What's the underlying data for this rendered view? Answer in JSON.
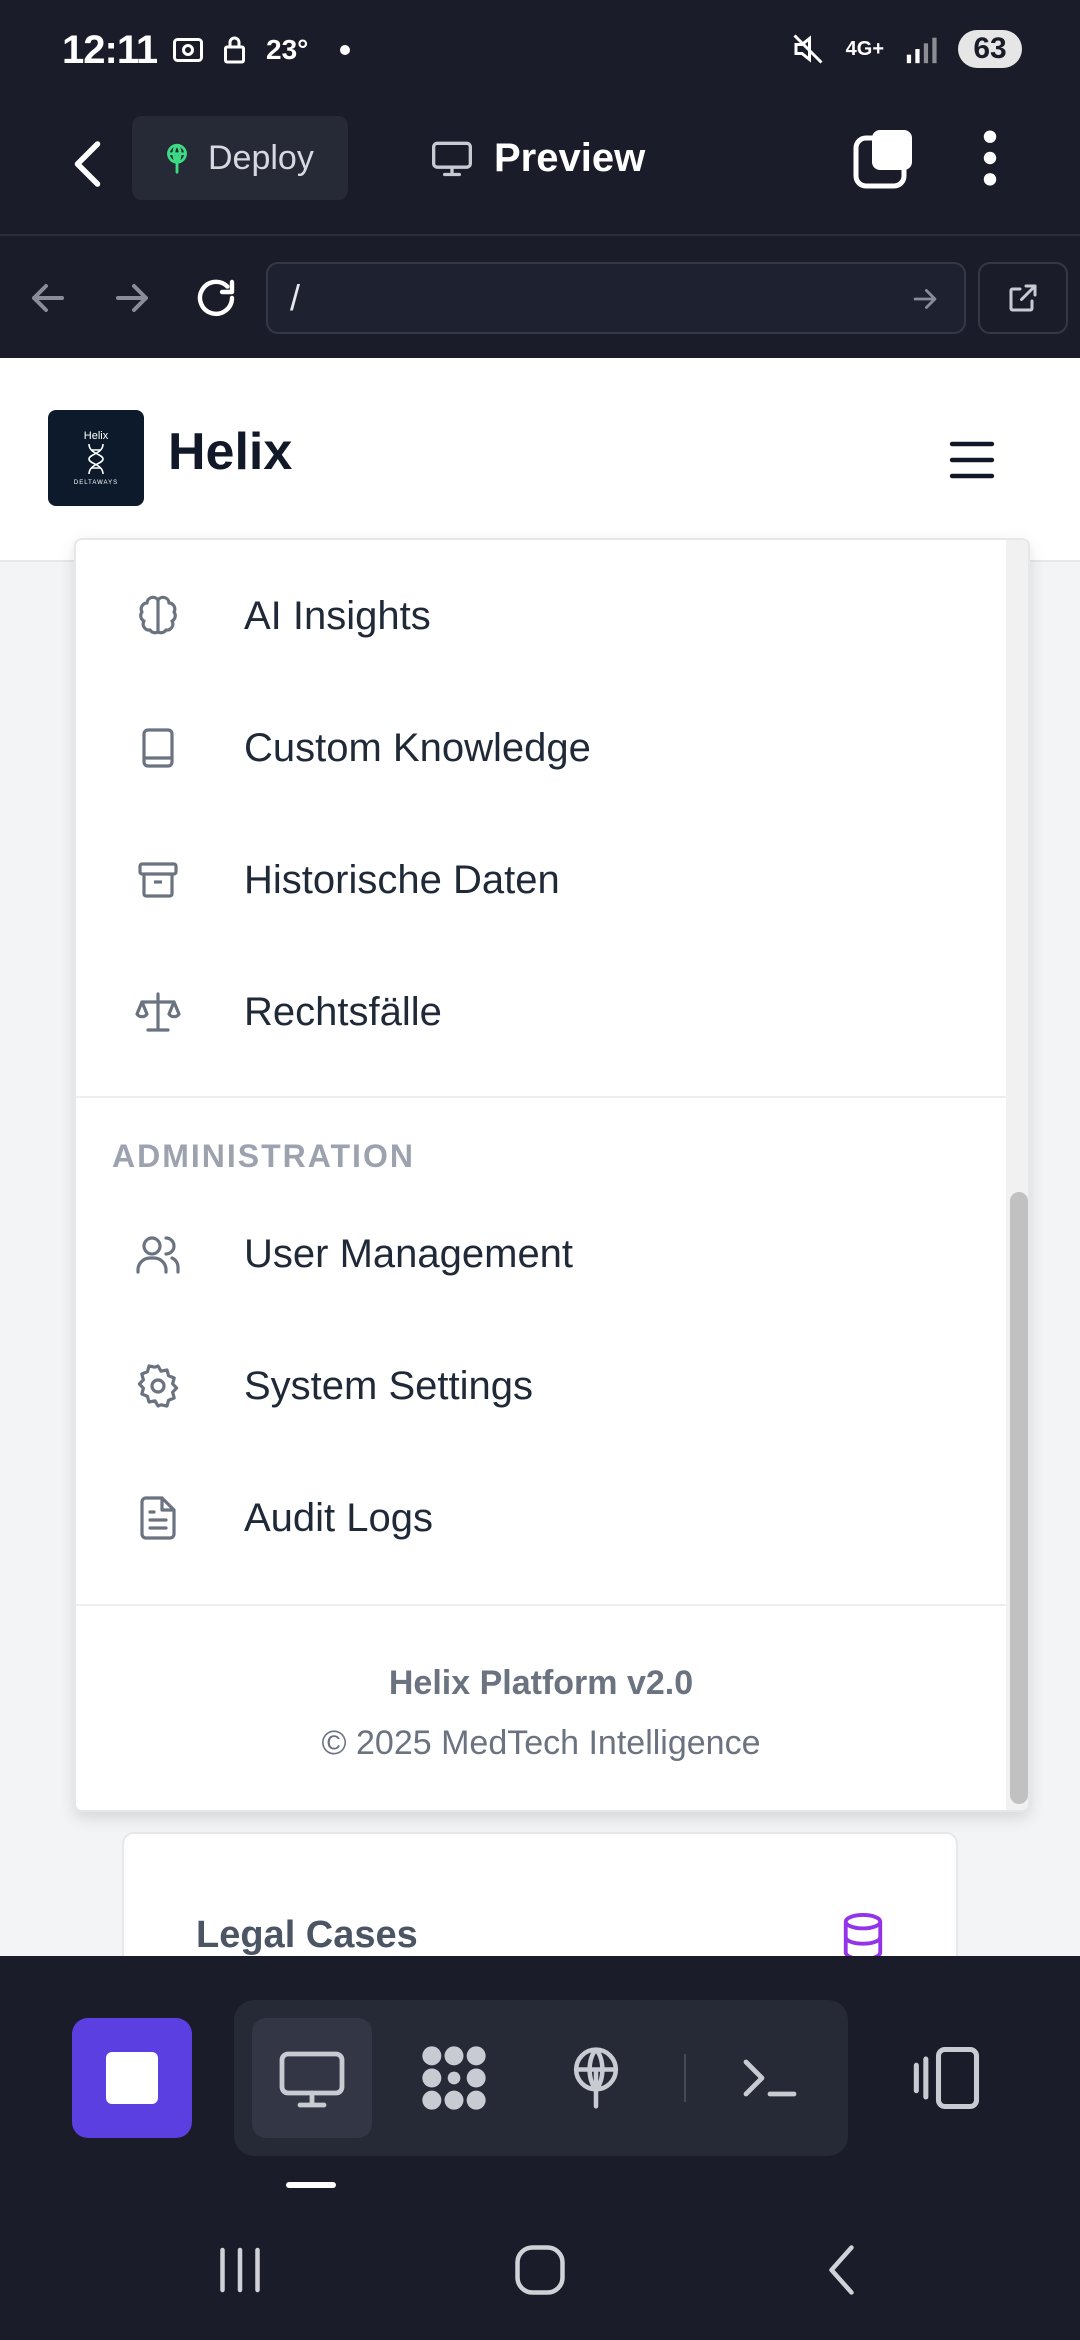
{
  "status_bar": {
    "time": "12:11",
    "temperature": "23°",
    "network": "4G+",
    "battery": "63"
  },
  "app_bar": {
    "deploy_label": "Deploy",
    "preview_label": "Preview"
  },
  "url_bar": {
    "url": "/"
  },
  "site": {
    "brand": "Helix",
    "logo_text": "Helix",
    "logo_sub": "DELTAWAYS"
  },
  "menu": {
    "items": [
      {
        "label": "AI Insights",
        "icon": "brain-icon"
      },
      {
        "label": "Custom Knowledge",
        "icon": "book-icon"
      },
      {
        "label": "Historische Daten",
        "icon": "archive-icon"
      },
      {
        "label": "Rechtsfälle",
        "icon": "scale-icon"
      }
    ],
    "admin_title": "ADMINISTRATION",
    "admin_items": [
      {
        "label": "User Management",
        "icon": "users-icon"
      },
      {
        "label": "System Settings",
        "icon": "gear-icon"
      },
      {
        "label": "Audit Logs",
        "icon": "document-icon"
      }
    ],
    "footer_version": "Helix Platform v2.0",
    "footer_copy": "© 2025 MedTech Intelligence"
  },
  "card": {
    "title": "Legal Cases",
    "icon": "database-icon"
  },
  "colors": {
    "accent": "#5b3fe0",
    "dark_bg": "#1a1c29",
    "deploy_icon": "#3ddc84",
    "database_icon": "#9333ea"
  }
}
